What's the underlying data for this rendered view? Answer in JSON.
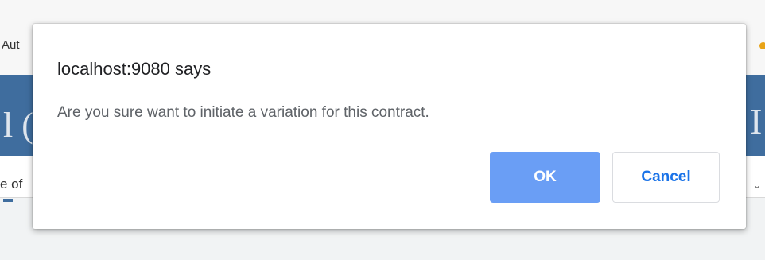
{
  "background": {
    "bookmark_fragment": "Aut",
    "banner_left_fragment": "l (",
    "banner_right_fragment": "I",
    "filter_fragment": "e of",
    "chevron": "⌄"
  },
  "dialog": {
    "title": "localhost:9080 says",
    "message": "Are you sure want to initiate a variation for this contract.",
    "ok_label": "OK",
    "cancel_label": "Cancel"
  },
  "colors": {
    "ok_button": "#6a9ef5",
    "cancel_text": "#1a73e8",
    "banner": "#3f6d9e"
  }
}
